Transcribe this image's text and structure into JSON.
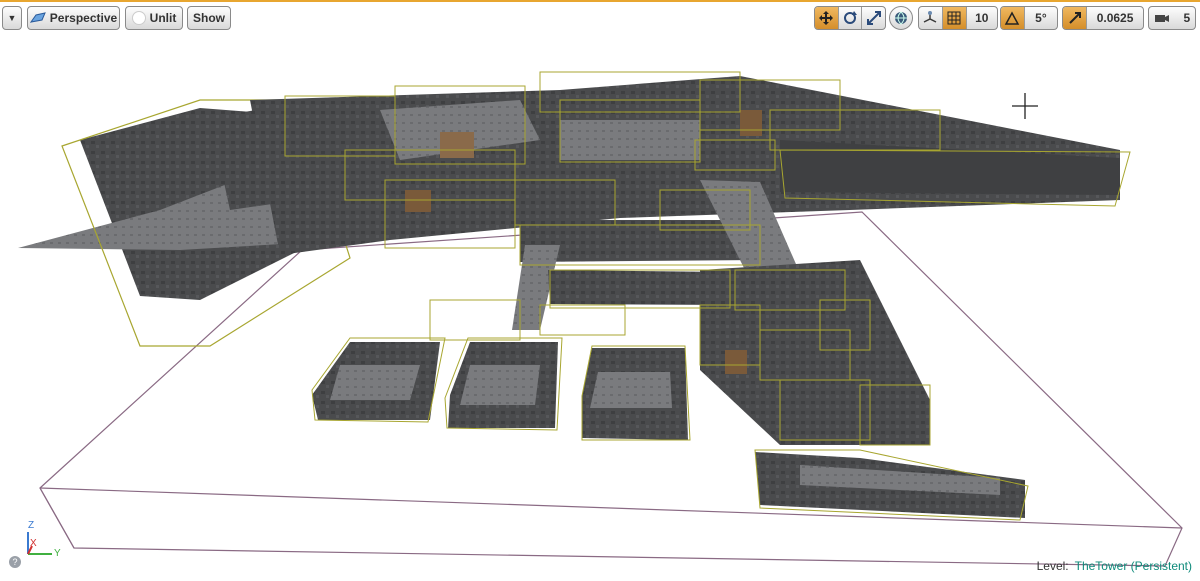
{
  "toolbar": {
    "viewport_mode": "Perspective",
    "lighting_mode": "Unlit",
    "show_label": "Show",
    "grid_snap_value": "10",
    "rotation_snap_value": "5°",
    "scale_snap_value": "0.0625",
    "camera_speed_value": "5"
  },
  "icons": {
    "translate": "move-icon",
    "rotate": "rotate-icon",
    "scale": "scale-icon",
    "world": "globe-icon",
    "surface_snap": "surface-snap-icon",
    "grid": "grid-icon",
    "angle": "angle-icon",
    "scale_snap": "scale-snap-icon",
    "camera": "camera-icon"
  },
  "status": {
    "level_label": "Level:",
    "level_name": "TheTower (Persistent)"
  },
  "axis": {
    "z": "Z",
    "x": "X",
    "y": "Y"
  },
  "colors": {
    "accent": "#e8a630",
    "bounds": "#a8a630",
    "level_link": "#0d8a7a",
    "floor_bounds": "#8a6a84"
  }
}
